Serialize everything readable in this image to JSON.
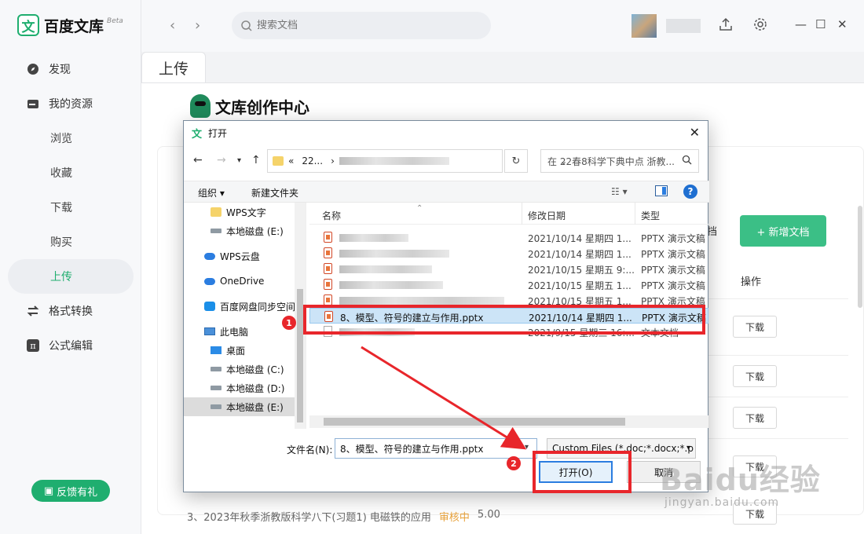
{
  "app": {
    "logo_mark": "文",
    "name": "百度文库",
    "beta": "Beta"
  },
  "sidebar": {
    "items": [
      {
        "label": "发现",
        "icon": "compass-icon"
      },
      {
        "label": "我的资源",
        "icon": "folder-icon"
      },
      {
        "label": "浏览"
      },
      {
        "label": "收藏"
      },
      {
        "label": "下载"
      },
      {
        "label": "购买"
      },
      {
        "label": "上传",
        "active": true
      },
      {
        "label": "格式转换",
        "icon": "convert-icon"
      },
      {
        "label": "公式编辑",
        "icon": "pi-icon"
      }
    ],
    "feedback": "反馈有礼"
  },
  "topbar": {
    "search_placeholder": "搜索文档"
  },
  "tabs": {
    "upload": "上传"
  },
  "creator": {
    "title": "文库创作中心"
  },
  "background": {
    "new_doc": "+ 新增文档",
    "partial_text": "挡",
    "op_header": "操作",
    "download": "下载",
    "bottom_row": [
      "3、2023年秋季浙教版科学八下(习题1) 电磁铁的应用",
      "审核中",
      "5.00"
    ]
  },
  "dialog": {
    "title_icon": "文",
    "title": "打开",
    "close": "✕",
    "address_prefix": "«",
    "address_seg": "22...",
    "address_sep": "›",
    "search_placeholder": "在 22春8科学下典中点 浙教...",
    "organize": "组织 ▾",
    "new_folder": "新建文件夹",
    "help": "?",
    "tree": [
      {
        "label": "WPS文字",
        "icon": "folder"
      },
      {
        "label": "本地磁盘 (E:)",
        "icon": "drive"
      },
      {
        "label": "WPS云盘",
        "icon": "cloud"
      },
      {
        "label": "OneDrive",
        "icon": "cloud"
      },
      {
        "label": "百度网盘同步空间",
        "icon": "baidu"
      },
      {
        "label": "此电脑",
        "icon": "pc"
      },
      {
        "label": "桌面",
        "icon": "desk"
      },
      {
        "label": "本地磁盘 (C:)",
        "icon": "drive"
      },
      {
        "label": "本地磁盘 (D:)",
        "icon": "drive"
      },
      {
        "label": "本地磁盘 (E:)",
        "icon": "drive",
        "selected": true
      }
    ],
    "columns": {
      "name": "名称",
      "date": "修改日期",
      "type": "类型"
    },
    "files": [
      {
        "name": "",
        "date": "2021/10/14 星期四 1...",
        "type": "PPTX 演示文稿"
      },
      {
        "name": "",
        "date": "2021/10/14 星期四 1...",
        "type": "PPTX 演示文稿"
      },
      {
        "name": "",
        "date": "2021/10/15 星期五 9:...",
        "type": "PPTX 演示文稿"
      },
      {
        "name": "",
        "date": "2021/10/15 星期五 1...",
        "type": "PPTX 演示文稿"
      },
      {
        "name": "",
        "date": "2021/10/15 星期五 1...",
        "type": "PPTX 演示文稿"
      },
      {
        "name": "8、模型、符号的建立与作用.pptx",
        "date": "2021/10/14 星期四 1...",
        "type": "PPTX 演示文稿",
        "selected": true
      },
      {
        "name": "",
        "date": "2021/9/15 星期三 16:...",
        "type": "文本文档",
        "kind": "txt"
      }
    ],
    "filename_label": "文件名(N):",
    "filename_value": "8、模型、符号的建立与作用.pptx",
    "filter": "Custom Files (*.doc;*.docx;*.p",
    "open": "打开(O)",
    "cancel": "取消"
  },
  "annotations": {
    "step1": "1",
    "step2": "2",
    "color": "#e8262b"
  },
  "watermark": {
    "brand": "Baidu经验",
    "url": "jingyan.baidu.com"
  }
}
